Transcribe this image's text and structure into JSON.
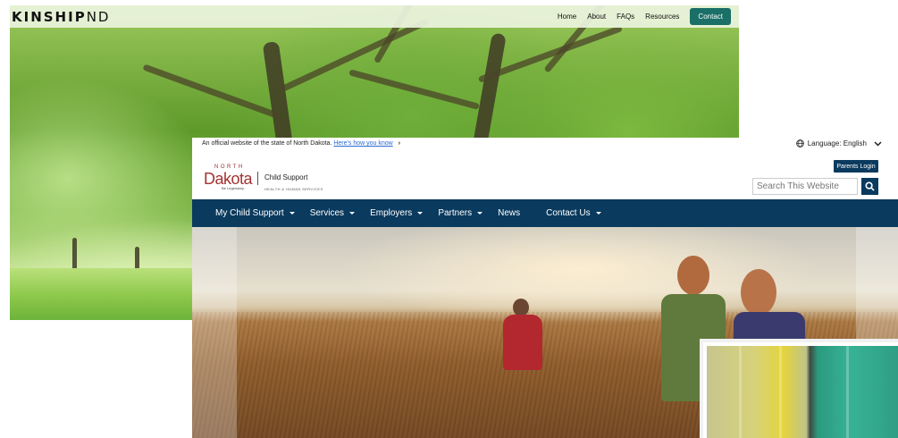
{
  "kinship": {
    "logo_bold": "KINSHIP",
    "logo_thin": "ND",
    "nav": {
      "home": "Home",
      "about": "About",
      "faqs": "FAQs",
      "resources": "Resources",
      "contact": "Contact"
    }
  },
  "nd": {
    "official_text": "An official website of the state of North Dakota.",
    "official_link": "Here's how you know",
    "language_label": "Language: English",
    "brand": {
      "north": "NORTH",
      "dakota": "Dakota",
      "tagline": "Be Legendary.",
      "department": "Child Support",
      "agency": "HEALTH & HUMAN SERVICES"
    },
    "parents_login": "Parents Login",
    "search": {
      "placeholder": "Search This Website"
    },
    "nav": {
      "my_child_support": "My Child Support",
      "services": "Services",
      "employers": "Employers",
      "partners": "Partners",
      "news": "News",
      "contact_us": "Contact Us"
    }
  },
  "icons": {
    "globe": "globe-icon",
    "chevron_down": "chevron-down-icon",
    "chevron_right": "chevron-right-icon",
    "search": "search-icon",
    "caret": "caret-down-icon"
  },
  "colors": {
    "nd_navy": "#0a3a5e",
    "nd_red": "#a43232",
    "kinship_teal": "#1a6f67",
    "link_blue": "#2a6ad1"
  }
}
